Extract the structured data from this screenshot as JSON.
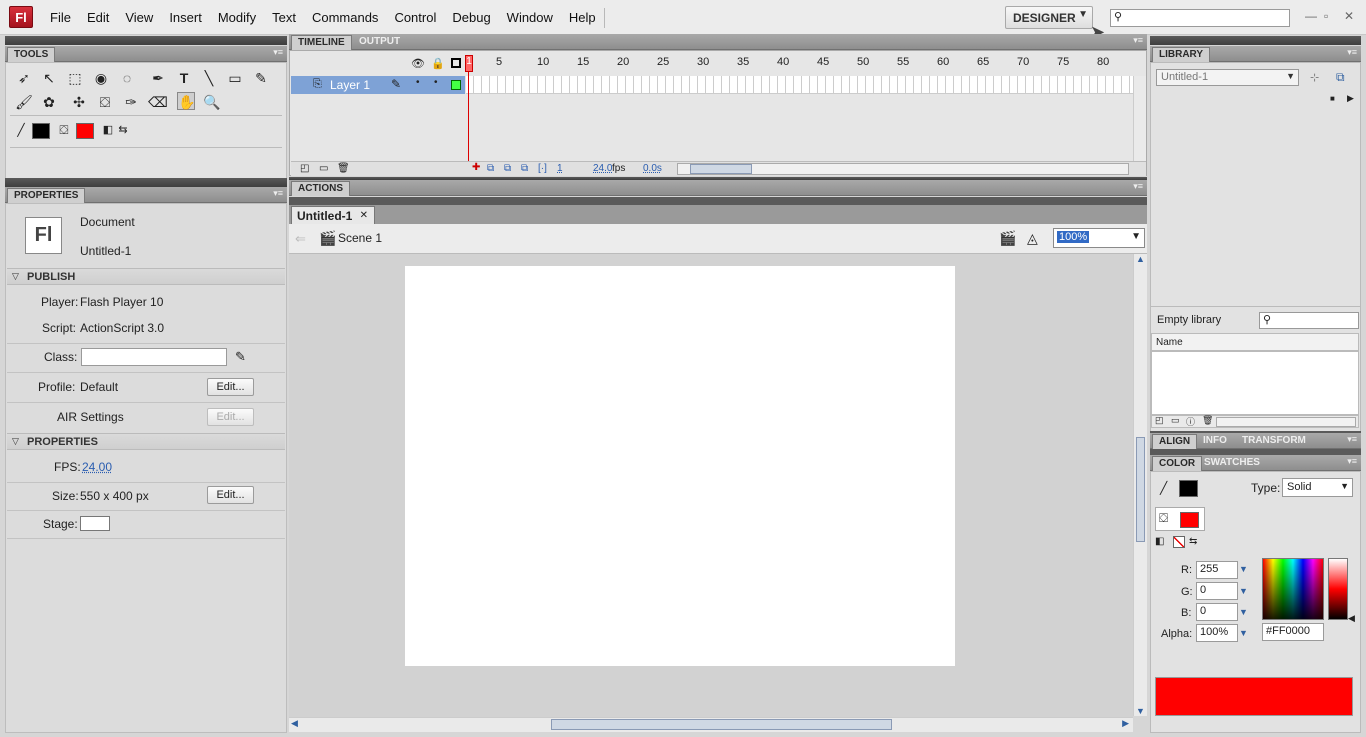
{
  "app": {
    "logo": "Fl",
    "workspace": "DESIGNER"
  },
  "menu": [
    "File",
    "Edit",
    "View",
    "Insert",
    "Modify",
    "Text",
    "Commands",
    "Control",
    "Debug",
    "Window",
    "Help"
  ],
  "tools": {
    "title": "TOOLS"
  },
  "timeline": {
    "tabs": [
      "TIMELINE",
      "OUTPUT"
    ],
    "ruler": [
      "1",
      "5",
      "10",
      "15",
      "20",
      "25",
      "30",
      "35",
      "40",
      "45",
      "50",
      "55",
      "60",
      "65",
      "70",
      "75",
      "80"
    ],
    "layer": "Layer 1",
    "frame": "1",
    "fps": "24.0",
    "fps_unit": "fps",
    "time": "0.0s"
  },
  "actions": {
    "title": "ACTIONS"
  },
  "document": {
    "tab": "Untitled-1",
    "close": "✕",
    "scene": "Scene 1",
    "zoom": "100%"
  },
  "properties": {
    "title": "PROPERTIES",
    "doc_type": "Document",
    "doc_name": "Untitled-1",
    "publish_header": "PUBLISH",
    "player_label": "Player:",
    "player_value": "Flash Player 10",
    "script_label": "Script:",
    "script_value": "ActionScript 3.0",
    "class_label": "Class:",
    "profile_label": "Profile:",
    "profile_value": "Default",
    "edit": "Edit...",
    "air_label": "AIR Settings",
    "props_header": "PROPERTIES",
    "fps_label": "FPS:",
    "fps_value": "24.00",
    "size_label": "Size:",
    "size_value": "550 x 400 px",
    "stage_label": "Stage:"
  },
  "library": {
    "title": "LIBRARY",
    "doc": "Untitled-1",
    "empty": "Empty library",
    "col_name": "Name"
  },
  "align_tabs": [
    "ALIGN",
    "INFO",
    "TRANSFORM"
  ],
  "color": {
    "tabs": [
      "COLOR",
      "SWATCHES"
    ],
    "type_label": "Type:",
    "type_value": "Solid",
    "r_label": "R:",
    "r": "255",
    "g_label": "G:",
    "g": "0",
    "b_label": "B:",
    "b": "0",
    "alpha_label": "Alpha:",
    "alpha": "100%",
    "hex": "#FF0000",
    "fill_color": "#ff0000",
    "stroke_color": "#000000"
  }
}
